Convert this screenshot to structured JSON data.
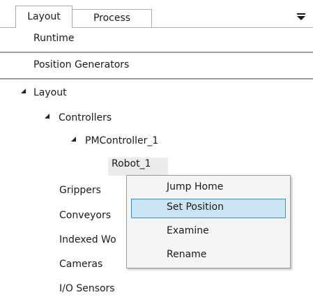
{
  "tabs": [
    {
      "label": "Layout",
      "active": true
    },
    {
      "label": "Process",
      "active": false
    }
  ],
  "tab_menu_icon": "menu-overflow-icon",
  "headers": {
    "runtime": "Runtime",
    "position_generators": "Position Generators"
  },
  "tree": {
    "layout": {
      "label": "Layout",
      "expanded": true
    },
    "controllers": {
      "label": "Controllers",
      "expanded": true
    },
    "pmcontroller": {
      "label": "PMController_1",
      "expanded": true
    },
    "robot": {
      "label": "Robot_1",
      "selected": true
    },
    "grippers": {
      "label": "Grippers"
    },
    "conveyors": {
      "label": "Conveyors"
    },
    "indexed": {
      "label": "Indexed Wo"
    },
    "cameras": {
      "label": "Cameras"
    },
    "io_sensors": {
      "label": "I/O Sensors"
    }
  },
  "context_menu": {
    "items": [
      {
        "label": "Jump Home"
      },
      {
        "label": "Set Position",
        "highlighted": true
      },
      {
        "label": "Examine"
      },
      {
        "label": "Rename"
      }
    ]
  },
  "colors": {
    "menu_highlight_bg": "#cce5f6",
    "menu_highlight_border": "#3a8fd6",
    "selected_node_bg": "#ececec"
  }
}
